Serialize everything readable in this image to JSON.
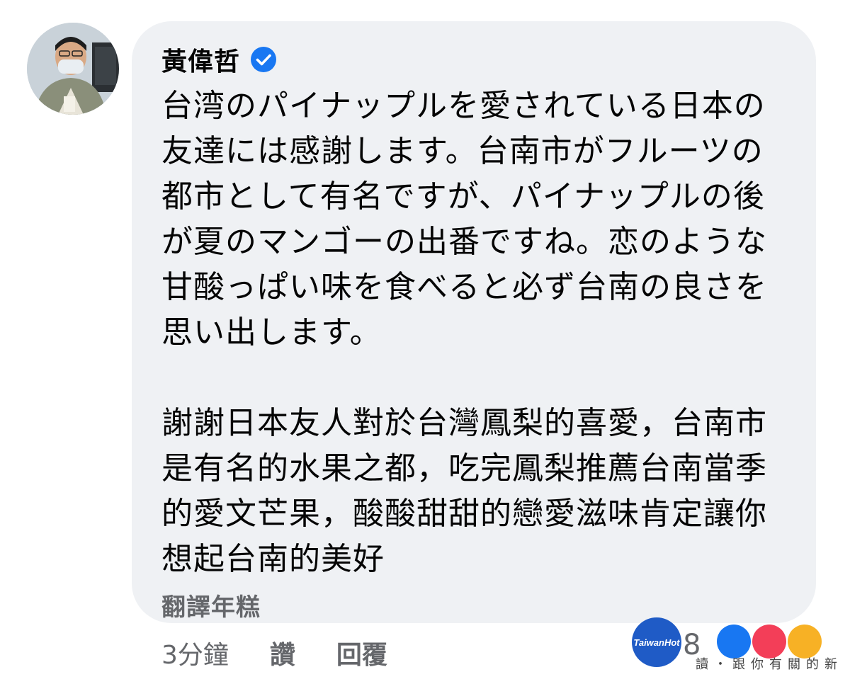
{
  "author": {
    "name": "黃偉哲",
    "verified": true,
    "avatar_icon": "profile-photo"
  },
  "comment": {
    "text_jp": "台湾のパイナップルを愛されている日本の友達には感謝します。台南市がフルーツの都市として有名ですが、パイナップルの後が夏のマンゴーの出番ですね。恋のような甘酸っぱい味を食べると必ず台南の良さを思い出します。",
    "text_zh": "謝謝日本友人對於台灣鳳梨的喜愛，台南市是有名的水果之都，吃完鳳梨推薦台南當季的愛文芒果，酸酸甜甜的戀愛滋味肯定讓你想起台南的美好",
    "translate_label": "翻譯年糕"
  },
  "actions": {
    "timestamp": "3分鐘",
    "like_label": "讚",
    "reply_label": "回覆"
  },
  "reactions": {
    "count": "8"
  },
  "watermark": {
    "logo_text": "TaiwanHot",
    "subtext": "讀・跟你有關的新"
  },
  "colors": {
    "bubble_bg": "#eff1f4",
    "verified_blue": "#1877f2",
    "secondary_text": "#65676b"
  }
}
